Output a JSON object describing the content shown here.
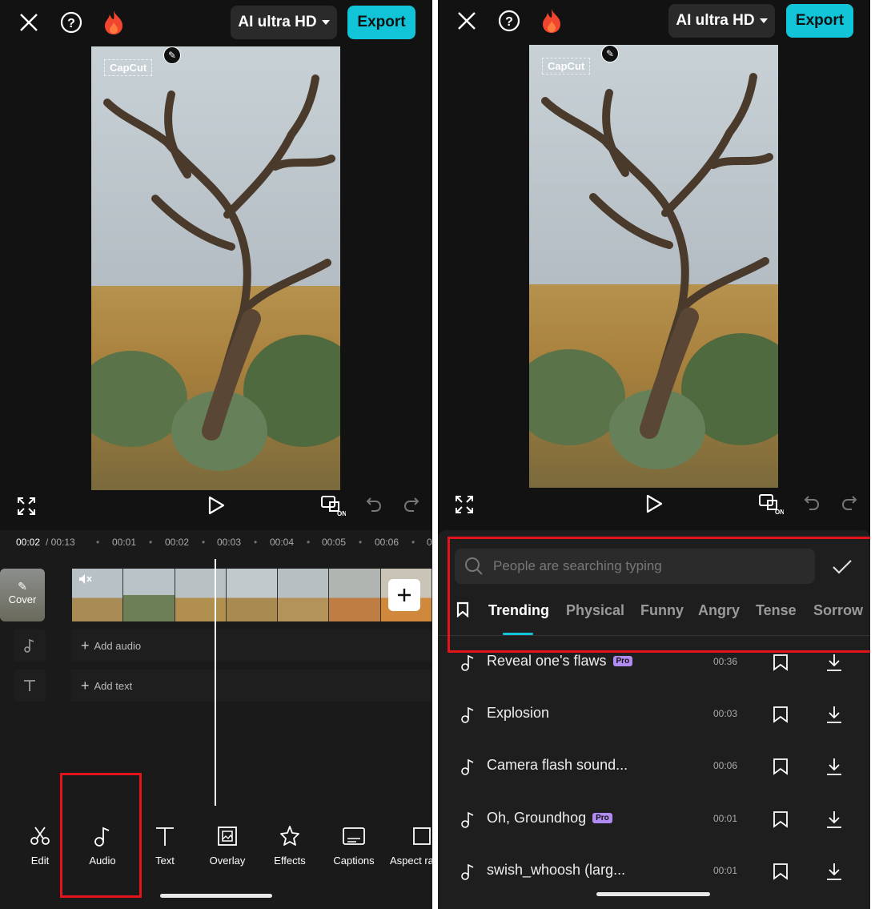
{
  "colors": {
    "accent": "#11c4d8",
    "highlight": "#e3141b",
    "background": "#121212"
  },
  "left": {
    "header": {
      "quality_label": "AI ultra HD",
      "export_label": "Export"
    },
    "watermark": "CapCut",
    "timeline": {
      "current": "00:02",
      "total": "/ 00:13",
      "marks": [
        "00:01",
        "00:02",
        "00:03",
        "00:04",
        "00:05",
        "00:06",
        "0"
      ]
    },
    "cover_label": "Cover",
    "add_audio": "Add audio",
    "add_text": "Add text",
    "toolbar": [
      {
        "label": "Edit",
        "icon": "scissors-icon"
      },
      {
        "label": "Audio",
        "icon": "music-note-icon"
      },
      {
        "label": "Text",
        "icon": "text-icon"
      },
      {
        "label": "Overlay",
        "icon": "overlay-icon"
      },
      {
        "label": "Effects",
        "icon": "effects-star-icon"
      },
      {
        "label": "Captions",
        "icon": "captions-icon"
      },
      {
        "label": "Aspect ra",
        "icon": "aspect-ratio-icon"
      }
    ]
  },
  "right": {
    "header": {
      "quality_label": "AI ultra HD",
      "export_label": "Export"
    },
    "watermark": "CapCut",
    "search_placeholder": "People are searching typing",
    "categories": [
      "Trending",
      "Physical",
      "Funny",
      "Angry",
      "Tense",
      "Sorrow"
    ],
    "active_category": "Trending",
    "songs": [
      {
        "title": "Reveal one's flaws",
        "pro": true,
        "duration": "00:36"
      },
      {
        "title": "Explosion",
        "pro": false,
        "duration": "00:03"
      },
      {
        "title": "Camera flash sound...",
        "pro": false,
        "duration": "00:06"
      },
      {
        "title": "Oh, Groundhog",
        "pro": true,
        "duration": "00:01"
      },
      {
        "title": "swish_whoosh (larg...",
        "pro": false,
        "duration": "00:01"
      }
    ],
    "pro_badge": "Pro"
  }
}
